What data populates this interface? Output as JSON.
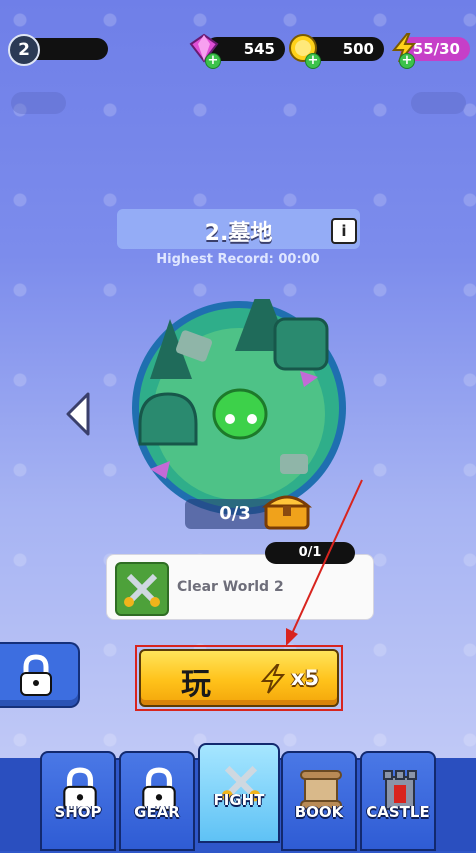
{
  "player": {
    "level": "2"
  },
  "resources": {
    "gems": {
      "value": "545",
      "icon": "gem-icon"
    },
    "coins": {
      "value": "500",
      "icon": "coin-icon"
    },
    "energy": {
      "value": "55/30",
      "icon": "lightning-icon"
    }
  },
  "stage": {
    "title": "2.墓地",
    "highest_record": "Highest Record: 00:00",
    "progress": "0/3"
  },
  "quest": {
    "label": "Clear World 2",
    "count": "0/1"
  },
  "play_button": {
    "label": "玩",
    "cost": "x5"
  },
  "nav": {
    "tabs": [
      {
        "label": "SHOP",
        "icon": "lock-icon",
        "locked": true
      },
      {
        "label": "GEAR",
        "icon": "lock-icon",
        "locked": true
      },
      {
        "label": "FIGHT",
        "icon": "crossed-swords-icon",
        "active": true
      },
      {
        "label": "BOOK",
        "icon": "scroll-icon"
      },
      {
        "label": "CASTLE",
        "icon": "castle-tower-icon"
      }
    ]
  },
  "colors": {
    "accent": "#ffc21a",
    "nav": "#2f57c9",
    "annotation": "#d8241e"
  }
}
